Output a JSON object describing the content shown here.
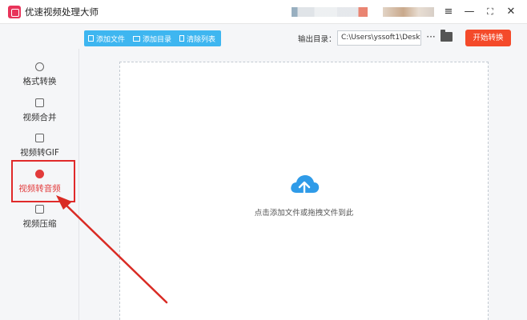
{
  "window": {
    "title": "优速视频处理大师",
    "controls": {
      "menu": "≡",
      "minimize": "—",
      "maximize": "⛶",
      "close": "✕"
    }
  },
  "toolbar": {
    "add_file": "添加文件",
    "add_folder": "添加目录",
    "clear_list": "清除列表",
    "output_label": "输出目录：",
    "output_path": "C:\\Users\\yssoft1\\Deskt",
    "more": "···",
    "start": "开始转换"
  },
  "sidebar": {
    "items": [
      {
        "label": "格式转换",
        "icon": "format-convert-icon"
      },
      {
        "label": "视频合并",
        "icon": "merge-icon"
      },
      {
        "label": "视频转GIF",
        "icon": "gif-icon"
      },
      {
        "label": "视频转音频",
        "icon": "audio-icon",
        "active": true
      },
      {
        "label": "视频压缩",
        "icon": "compress-icon"
      }
    ]
  },
  "dropzone": {
    "hint": "点击添加文件或拖拽文件到此"
  },
  "colors": {
    "toolbar_blue": "#3eb6f0",
    "start_red": "#f44a2a",
    "highlight_red": "#e02a2a",
    "cloud_blue": "#2f9be8"
  }
}
